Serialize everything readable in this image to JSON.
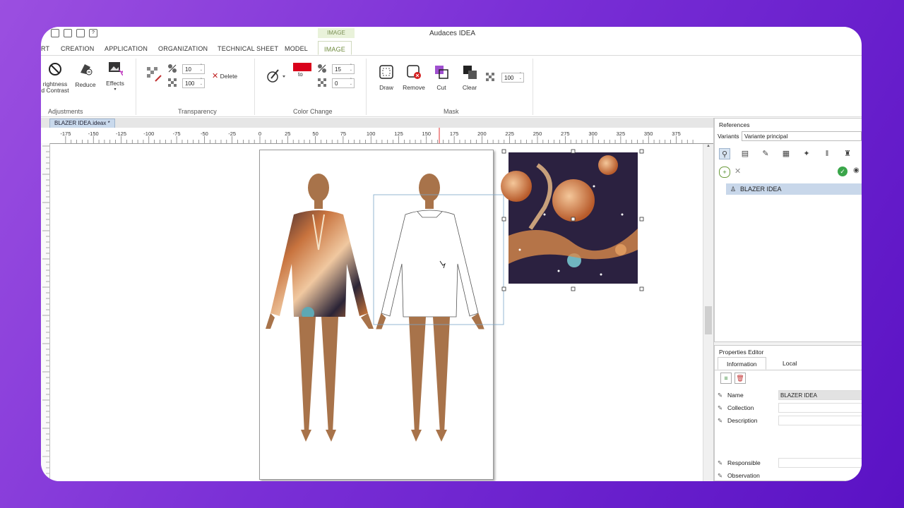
{
  "app": {
    "title": "Audaces IDEA",
    "context_label": "IMAGE"
  },
  "tabs": [
    "RT",
    "CREATION",
    "APPLICATION",
    "ORGANIZATION",
    "TECHNICAL SHEET",
    "MODEL",
    "IMAGE"
  ],
  "ribbon": {
    "adjustments": {
      "label": "Adjustments",
      "brightness": "rightness\nd Contrast",
      "reduce": "Reduce",
      "effects": "Effects"
    },
    "transparency": {
      "label": "Transparency",
      "value1": "10",
      "value2": "100",
      "delete": "Delete"
    },
    "color_change": {
      "label": "Color Change",
      "to": "to",
      "value1": "15",
      "value2": "0",
      "swatch_color": "#d9001b"
    },
    "mask": {
      "label": "Mask",
      "draw": "Draw",
      "remove": "Remove",
      "cut": "Cut",
      "clear": "Clear",
      "value": "100"
    }
  },
  "document": {
    "tab": "BLAZER IDEA.ideax *"
  },
  "ruler": {
    "ticks": [
      "-175",
      "-150",
      "-125",
      "-100",
      "-75",
      "-50",
      "-25",
      "0",
      "25",
      "50",
      "75",
      "100",
      "125",
      "150",
      "175",
      "200",
      "225",
      "250",
      "275",
      "300",
      "325",
      "350",
      "375"
    ]
  },
  "references": {
    "title": "References",
    "variants_label": "Variants",
    "variants_value": "Variante principal",
    "item": "BLAZER IDEA"
  },
  "properties": {
    "title": "Properties Editor",
    "tab_information": "Information",
    "tab_local": "Local",
    "rows": [
      {
        "label": "Name",
        "value": "BLAZER IDEA"
      },
      {
        "label": "Collection",
        "value": ""
      },
      {
        "label": "Description",
        "value": ""
      },
      {
        "label": "Responsible",
        "value": ""
      },
      {
        "label": "Observation",
        "value": ""
      }
    ]
  },
  "colors": {
    "accent_tab": "#6d8a3b",
    "selection": "#c8d7ea",
    "skin": "#a8734a"
  }
}
